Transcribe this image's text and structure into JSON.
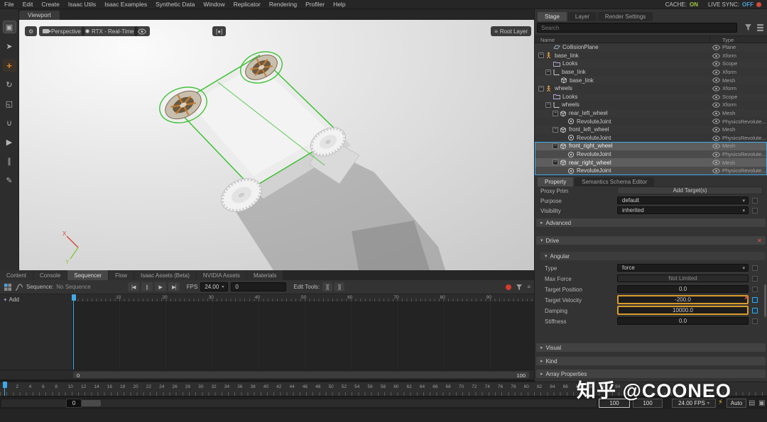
{
  "menu_bar": {
    "items": [
      "File",
      "Edit",
      "Create",
      "Isaac Utils",
      "Isaac Examples",
      "Synthetic Data",
      "Window",
      "Replicator",
      "Rendering",
      "Profiler",
      "Help"
    ],
    "cache_label": "CACHE:",
    "cache_value": "ON",
    "live_sync_label": "LIVE SYNC:",
    "live_sync_value": "OFF"
  },
  "left_toolbar": {
    "tools": [
      {
        "name": "viewport-camera-tool",
        "glyph": "▣",
        "active": true
      },
      {
        "name": "select-tool",
        "glyph": "➤"
      },
      {
        "name": "move-tool",
        "glyph": "+",
        "accent": true
      },
      {
        "name": "rotate-tool",
        "glyph": "↻"
      },
      {
        "name": "scale-tool",
        "glyph": "◱"
      },
      {
        "name": "snap-tool",
        "glyph": "∪"
      },
      {
        "name": "play-tool",
        "glyph": "▶"
      },
      {
        "name": "pause-tool",
        "glyph": "∥"
      },
      {
        "name": "paint-tool",
        "glyph": "✎"
      }
    ]
  },
  "viewport": {
    "tab": "Viewport",
    "perspective_button": "Perspective",
    "renderer_button": "RTX - Real-Time",
    "capture_glyph": "[●]",
    "root_layer_button": "Root Layer",
    "axis_x": "X",
    "axis_y": "Y"
  },
  "stage_panel": {
    "tabs": [
      {
        "label": "Stage",
        "active": true
      },
      {
        "label": "Layer",
        "active": false
      },
      {
        "label": "Render Settings",
        "active": false
      }
    ],
    "search_placeholder": "Search",
    "columns": {
      "name": "Name",
      "type": "Type"
    },
    "rows": [
      {
        "label": "CollisionPlane",
        "type": "Plane",
        "indent": 1,
        "icon": "plane",
        "expanded": false,
        "selected": false
      },
      {
        "label": "base_link",
        "type": "Xform",
        "indent": 0,
        "icon": "articulation",
        "expanded": true,
        "selected": false
      },
      {
        "label": "Looks",
        "type": "Scope",
        "indent": 1,
        "icon": "scope",
        "expanded": false,
        "selected": false
      },
      {
        "label": "base_link",
        "type": "Xform",
        "indent": 1,
        "icon": "xform",
        "expanded": true,
        "selected": false
      },
      {
        "label": "base_link",
        "type": "Mesh",
        "indent": 2,
        "icon": "mesh",
        "expanded": false,
        "selected": false
      },
      {
        "label": "wheels",
        "type": "Xform",
        "indent": 0,
        "icon": "articulation",
        "expanded": true,
        "selected": false
      },
      {
        "label": "Looks",
        "type": "Scope",
        "indent": 1,
        "icon": "scope",
        "expanded": false,
        "selected": false
      },
      {
        "label": "wheels",
        "type": "Xform",
        "indent": 1,
        "icon": "xform",
        "expanded": true,
        "selected": false
      },
      {
        "label": "rear_left_wheel",
        "type": "Mesh",
        "indent": 2,
        "icon": "mesh",
        "expanded": true,
        "selected": false
      },
      {
        "label": "RevoluteJoint",
        "type": "PhysicsRevolute...",
        "indent": 3,
        "icon": "joint",
        "expanded": false,
        "selected": false
      },
      {
        "label": "front_left_wheel",
        "type": "Mesh",
        "indent": 2,
        "icon": "mesh",
        "expanded": true,
        "selected": false
      },
      {
        "label": "RevoluteJoint",
        "type": "PhysicsRevolute...",
        "indent": 3,
        "icon": "joint",
        "expanded": false,
        "selected": false
      },
      {
        "label": "front_right_wheel",
        "type": "Mesh",
        "indent": 2,
        "icon": "mesh",
        "expanded": true,
        "selected": true
      },
      {
        "label": "RevoluteJoint",
        "type": "PhysicsRevolute...",
        "indent": 3,
        "icon": "joint",
        "expanded": false,
        "selected": true
      },
      {
        "label": "rear_right_wheel",
        "type": "Mesh",
        "indent": 2,
        "icon": "mesh",
        "expanded": true,
        "selected": true
      },
      {
        "label": "RevoluteJoint",
        "type": "PhysicsRevolute...",
        "indent": 3,
        "icon": "joint",
        "expanded": false,
        "selected": true
      }
    ]
  },
  "property_panel": {
    "tabs": [
      {
        "label": "Property",
        "active": true
      },
      {
        "label": "Semantics Schema Editor",
        "active": false
      }
    ],
    "proxy_prim_label": "Proxy Prim",
    "add_targets_button": "Add Target(s)",
    "rows_top": [
      {
        "label": "Purpose",
        "value": "default",
        "widget": "dropdown"
      },
      {
        "label": "Visibility",
        "value": "inherited",
        "widget": "dropdown"
      }
    ],
    "section_advanced": "Advanced",
    "section_drive": "Drive",
    "section_angular": "Angular",
    "drive_rows": [
      {
        "label": "Type",
        "value": "force",
        "widget": "dropdown"
      },
      {
        "label": "Max Force",
        "value": "Not Limited",
        "disabled": true
      },
      {
        "label": "Target Position",
        "value": "0.0"
      },
      {
        "label": "Target Velocity",
        "value": "-200.0",
        "highlight": true,
        "blue_widget": true,
        "remove_icon": true
      },
      {
        "label": "Damping",
        "value": "10000.0",
        "highlight": true,
        "blue_widget": true
      },
      {
        "label": "Stiffness",
        "value": "0.0"
      }
    ],
    "section_visual": "Visual",
    "section_kind": "Kind",
    "section_array": "Array Properties"
  },
  "bottom_tabs": [
    {
      "label": "Content",
      "active": false
    },
    {
      "label": "Console",
      "active": false
    },
    {
      "label": "Sequencer",
      "active": true
    },
    {
      "label": "Flow",
      "active": false
    },
    {
      "label": "Isaac Assets (Beta)",
      "active": false
    },
    {
      "label": "NVIDIA Assets",
      "active": false
    },
    {
      "label": "Materials",
      "active": false
    }
  ],
  "sequencer": {
    "sequence_label": "Sequence:",
    "sequence_value": "No Sequence",
    "transport": [
      {
        "name": "go-to-start-button",
        "glyph": "|◀"
      },
      {
        "name": "pause-button",
        "glyph": "∥"
      },
      {
        "name": "play-button",
        "glyph": "▶"
      },
      {
        "name": "go-to-end-button",
        "glyph": "▶|"
      }
    ],
    "fps_label": "FPS",
    "fps_value": "24.00",
    "frame_value": "0",
    "edit_tools_label": "Edit Tools:",
    "edit_tools": [
      {
        "name": "edit-tool-trim",
        "glyph": "]["
      },
      {
        "name": "edit-tool-slip",
        "glyph": "]["
      }
    ],
    "add_button": "Add",
    "ruler": [
      "10",
      "20",
      "30",
      "40",
      "50",
      "60",
      "70",
      "80",
      "90"
    ],
    "range_start": "0",
    "range_end": "100"
  },
  "timeline": {
    "ticks": [
      "0",
      "2",
      "4",
      "6",
      "8",
      "10",
      "12",
      "14",
      "16",
      "18",
      "20",
      "22",
      "24",
      "26",
      "28",
      "30",
      "32",
      "34",
      "36",
      "38",
      "40",
      "42",
      "44",
      "46",
      "48",
      "50",
      "52",
      "54",
      "56",
      "58",
      "60",
      "62",
      "64",
      "66",
      "68",
      "70",
      "72",
      "74",
      "76",
      "78",
      "80",
      "82",
      "84",
      "86",
      "88",
      "90",
      "92",
      "94",
      "96"
    ],
    "range_start_box": "0",
    "end_box_a": "100",
    "end_box_b": "100",
    "fps_dropdown": "24.00 FPS",
    "auto_button": "Auto"
  },
  "watermark": "知乎 @COONEO"
}
